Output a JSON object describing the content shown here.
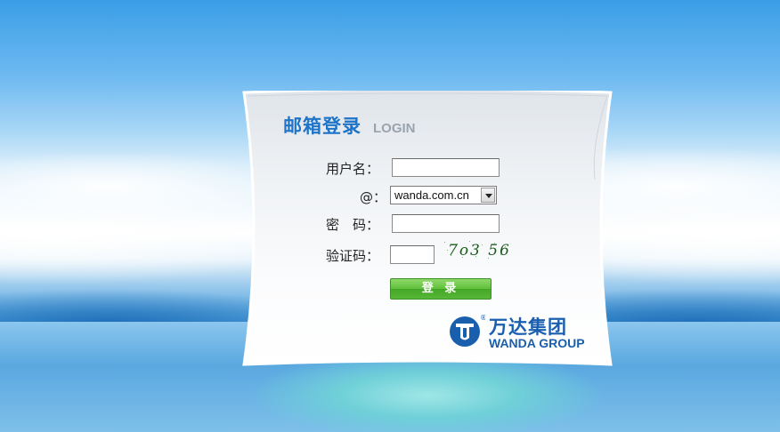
{
  "form": {
    "title": "邮箱登录",
    "title_sub": "LOGIN",
    "username_label": "用户名：",
    "domain_label": "@：",
    "domain_value": "wanda.com.cn",
    "password_label": "密　码：",
    "captcha_label": "验证码：",
    "captcha_text": "7o3 56",
    "login_button": "登 录"
  },
  "logo": {
    "name_cn": "万达集团",
    "name_en": "WANDA GROUP",
    "registered_mark": "®"
  },
  "colors": {
    "brand_blue": "#1a5fae",
    "title_blue": "#1d74c8",
    "button_green": "#57b838"
  }
}
